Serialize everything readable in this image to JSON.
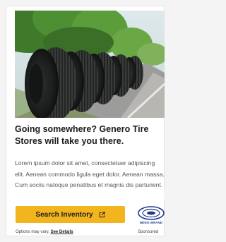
{
  "ad": {
    "headline": "Going somewhere? Genero Tire Stores will take you there.",
    "body": "Lorem ipsum dolor sit amet, consectetuer adipiscing elit. Aenean commodo ligula eget dolor. Aenean massa. Cum sociis natoque penatibus et magnis dis parturient.",
    "cta_label": "Search Inventory",
    "cta_icon": "external-link-icon",
    "brand_name": "NENO BRAND",
    "disclaimer_text": "Options may vary.",
    "details_link": "See Details",
    "sponsored_label": "Sponsored"
  },
  "colors": {
    "cta_background": "#f2b51f",
    "brand_blue": "#1f3b8c",
    "headline": "#1b1b1b"
  },
  "image": {
    "subject": "row of tires on roadside with trees"
  }
}
